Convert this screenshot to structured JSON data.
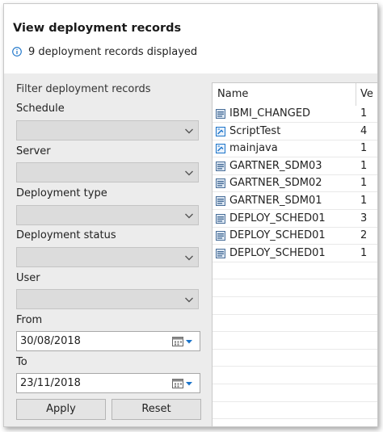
{
  "header": {
    "title": "View deployment records",
    "info": "9 deployment records displayed"
  },
  "filter": {
    "title": "Filter deployment records",
    "schedule_label": "Schedule",
    "server_label": "Server",
    "type_label": "Deployment type",
    "status_label": "Deployment status",
    "user_label": "User",
    "from_label": "From",
    "from_value": "30/08/2018",
    "to_label": "To",
    "to_value": "23/11/2018",
    "apply": "Apply",
    "reset": "Reset"
  },
  "table": {
    "col_name": "Name",
    "col_version": "Ve",
    "rows": [
      {
        "name": "IBMI_CHANGED",
        "version": "1",
        "icon": "deployment-icon"
      },
      {
        "name": "ScriptTest",
        "version": "4",
        "icon": "script-icon"
      },
      {
        "name": "mainjava",
        "version": "1",
        "icon": "script-icon"
      },
      {
        "name": "GARTNER_SDM03",
        "version": "1",
        "icon": "deployment-icon"
      },
      {
        "name": "GARTNER_SDM02",
        "version": "1",
        "icon": "deployment-icon"
      },
      {
        "name": "GARTNER_SDM01",
        "version": "1",
        "icon": "deployment-icon"
      },
      {
        "name": "DEPLOY_SCHED01",
        "version": "3",
        "icon": "deployment-icon"
      },
      {
        "name": "DEPLOY_SCHED01",
        "version": "2",
        "icon": "deployment-icon"
      },
      {
        "name": "DEPLOY_SCHED01",
        "version": "1",
        "icon": "deployment-icon"
      }
    ]
  },
  "colors": {
    "accent": "#1a73c9",
    "panel_bg": "#ececec",
    "combo_bg": "#dcdcdc"
  }
}
